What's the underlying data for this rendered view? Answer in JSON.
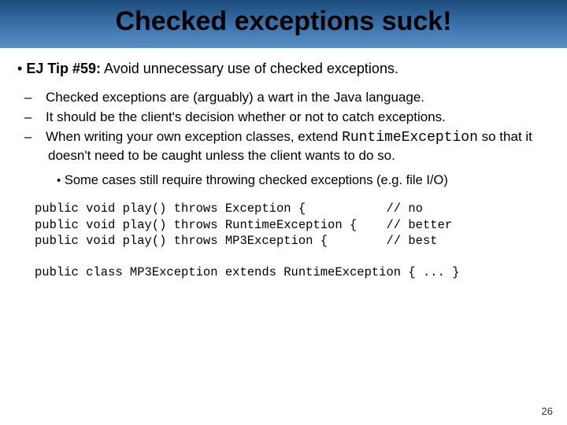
{
  "title": "Checked exceptions suck!",
  "main": {
    "bullet": "•",
    "tip_label": "EJ Tip #59:",
    "tip_text": " Avoid unnecessary use of checked exceptions."
  },
  "subs": {
    "s1": "Checked exceptions are (arguably) a wart in the Java language.",
    "s2": "It should be the client's decision whether or not to catch exceptions.",
    "s3a": "When writing your own exception classes, extend ",
    "s3code": "RuntimeException",
    "s3b": " so that it doesn't need to be caught unless the client wants to do so."
  },
  "subsub": {
    "bullet": "•",
    "text": "Some cases still require throwing checked exceptions  (e.g. file I/O)"
  },
  "code": {
    "line1": "public void play() throws Exception {           // no",
    "line2": "public void play() throws RuntimeException {    // better",
    "line3": "public void play() throws MP3Exception {        // best",
    "blank": "",
    "line4": "public class MP3Exception extends RuntimeException { ... }"
  },
  "page": "26"
}
